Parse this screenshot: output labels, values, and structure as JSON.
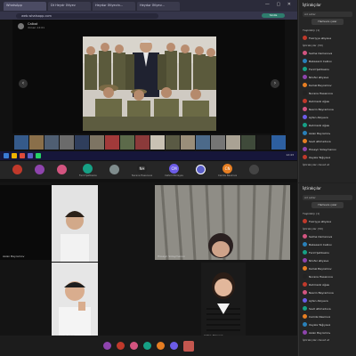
{
  "browser": {
    "tabs": [
      "WhatsApp",
      "Dt Heydr Əliyev",
      "Heydər Əliyevin...",
      "Heydər Əliyev..."
    ],
    "window_controls": "— ▢ ✕",
    "address": "web.whatsapp.com",
    "badge": "Yenilə"
  },
  "viewer": {
    "author": "Calbat",
    "date": "dünən 12:01",
    "prev": "‹",
    "next": "›"
  },
  "taskbar": {
    "time": "12:43"
  },
  "participants_row1": [
    {
      "initials": "",
      "label": ""
    },
    {
      "initials": "",
      "label": ""
    },
    {
      "initials": "",
      "label": ""
    },
    {
      "initials": "",
      "label": "Fərid Şahbazov"
    },
    {
      "initials": "",
      "label": ""
    },
    {
      "initials": "NH",
      "label": "Nuranə Həsənova"
    },
    {
      "initials": "CM",
      "label": "Cəfərli Mirzəyev"
    },
    {
      "initials": "",
      "label": ""
    },
    {
      "initials": "CN",
      "label": "Cəmilə Nəsirova"
    },
    {
      "initials": "",
      "label": ""
    }
  ],
  "video_cells": [
    {
      "label": "Aslan Bayramov"
    },
    {
      "label": "Hüseyn Süleymanov"
    },
    {
      "label": "Rəhmanli Ağası"
    },
    {
      "label": "Aytən Abiyeva"
    }
  ],
  "sidebar_top": {
    "title": "İştirakçılar",
    "search": "Ad axtar",
    "button": "Hamısını çıxar",
    "section1": "Təşkilatçı (1)",
    "section2": "İştirakçılar (30)",
    "people": [
      "Fəxriyyə Əliyeva",
      "Salma Osmanova",
      "Babaxanli Cəlilov",
      "Fərid Şahbazov",
      "Nilufər Əliyeva",
      "Kamal Bayramov",
      "Nuranə Həsənova",
      "Rəhmanli Ağası",
      "Nəsrin Bayramova",
      "Aytən Abiyeva",
      "Rəhmanli Ağası",
      "Aslan Bayramov",
      "Sevil Əhmədova",
      "Hüseyn Süleymanov",
      "Xəyalə Tağıyeva"
    ],
    "footer": "İştirakçıları dəvət et"
  },
  "sidebar_bottom": {
    "title": "İştirakçılar",
    "search": "Ad axtar",
    "button": "Hamısını çıxar",
    "section1": "Təşkilatçı (1)",
    "section2": "İştirakçılar (30)",
    "people": [
      "Fəxriyyə Əliyeva",
      "Salma Osmanova",
      "Babaxanli Cəlilov",
      "Fərid Şahbazov",
      "Nilufər Əliyeva",
      "Kamal Bayramov",
      "Nuranə Həsənova",
      "Rəhmanli Ağası",
      "Nəsrin Bayramova",
      "Aytən Abiyeva",
      "Sevil Əhmədova",
      "Cəmilə Nəsirova",
      "Xəyalə Tağıyeva",
      "Aslan Bayramov"
    ],
    "footer": "İştirakçıları dəvət et"
  }
}
